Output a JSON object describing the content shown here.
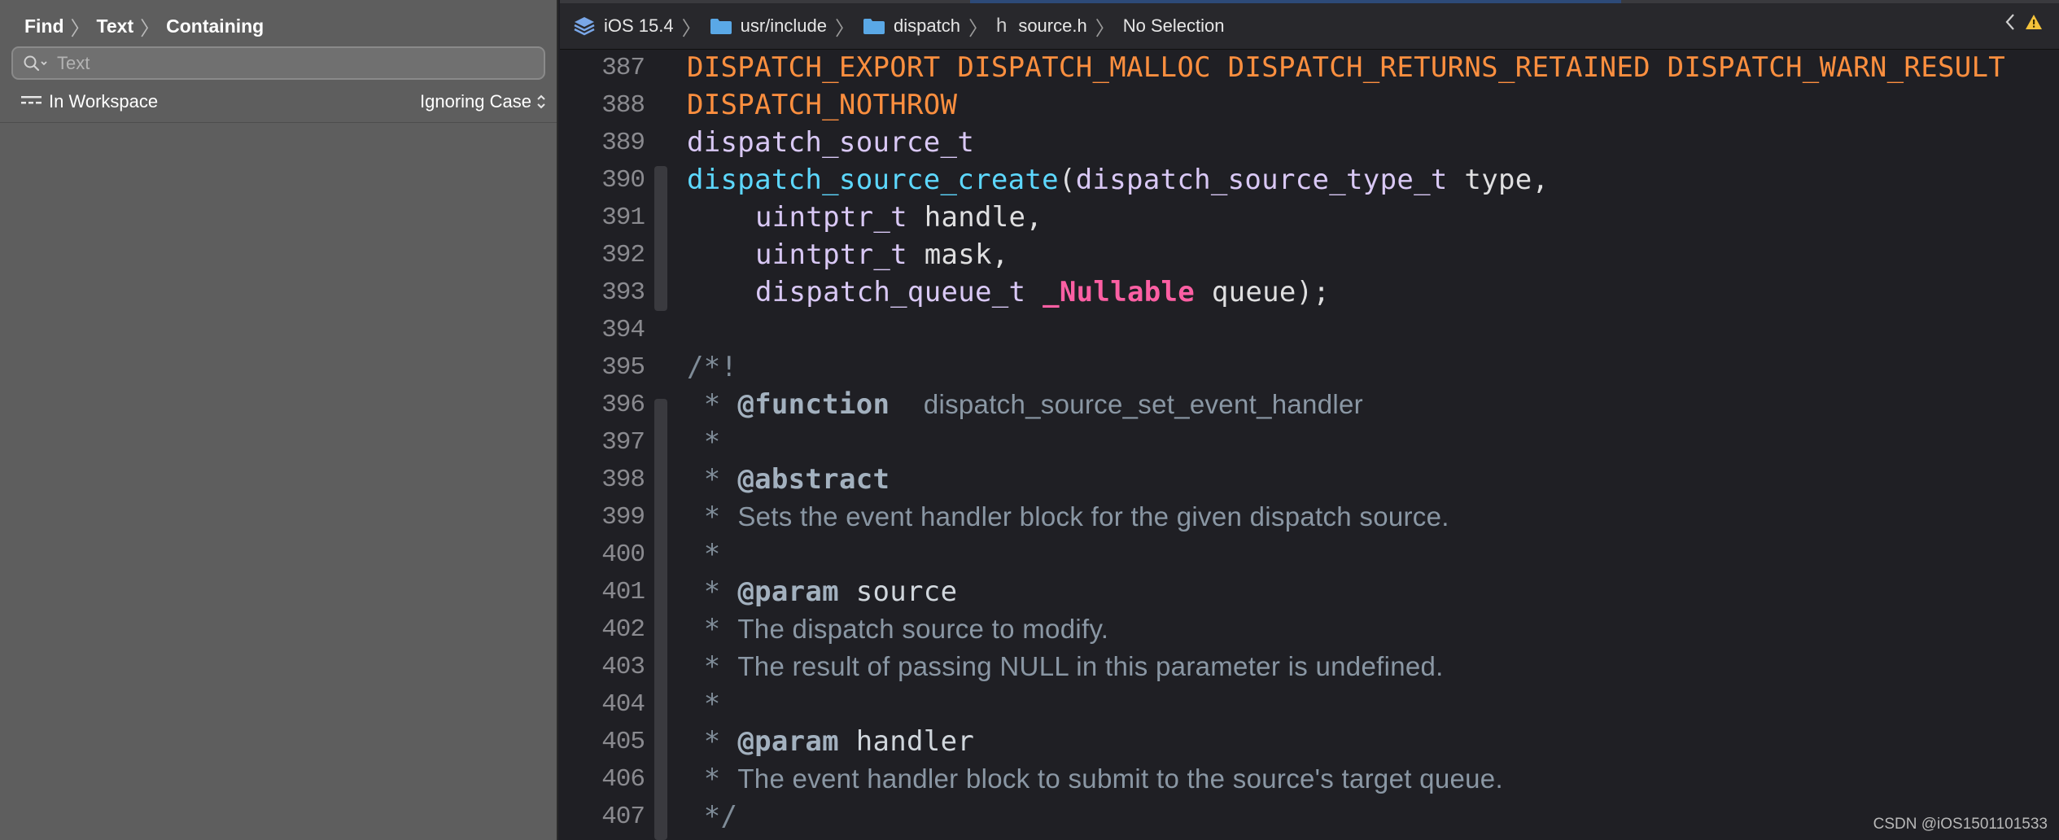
{
  "navigator": {
    "find_mode": "Find",
    "find_type": "Text",
    "find_match": "Containing",
    "search_placeholder": "Text",
    "search_value": "",
    "scope": "In Workspace",
    "case_option": "Ignoring Case"
  },
  "jumpbar": {
    "sdk": "iOS 15.4",
    "folder1": "usr/include",
    "folder2": "dispatch",
    "file_prefix": "h",
    "file": "source.h",
    "selection": "No Selection"
  },
  "colors": {
    "macro": "#fd8f3f",
    "type": "#d9c8f5",
    "function": "#5dd8ff",
    "keyword": "#fc5fa3",
    "comment": "#7f8c98",
    "warning": "#f5c33b"
  },
  "code": {
    "lines": [
      {
        "n": "387"
      },
      {
        "n": "388"
      },
      {
        "n": "389"
      },
      {
        "n": "390"
      },
      {
        "n": "391"
      },
      {
        "n": "392"
      },
      {
        "n": "393"
      },
      {
        "n": "394"
      },
      {
        "n": "395"
      },
      {
        "n": "396"
      },
      {
        "n": "397"
      },
      {
        "n": "398"
      },
      {
        "n": "399"
      },
      {
        "n": "400"
      },
      {
        "n": "401"
      },
      {
        "n": "402"
      },
      {
        "n": "403"
      },
      {
        "n": "404"
      },
      {
        "n": "405"
      },
      {
        "n": "406"
      },
      {
        "n": "407"
      }
    ],
    "l387": "DISPATCH_EXPORT DISPATCH_MALLOC DISPATCH_RETURNS_RETAINED DISPATCH_WARN_RESULT",
    "l388": "DISPATCH_NOTHROW",
    "l389": "dispatch_source_t",
    "l390_func": "dispatch_source_create",
    "l390_open": "(",
    "l390_type": "dispatch_source_type_t",
    "l390_rest": " type,",
    "l391_type": "uintptr_t",
    "l391_rest": " handle,",
    "l392_type": "uintptr_t",
    "l392_rest": " mask,",
    "l393_type": "dispatch_queue_t",
    "l393_kw": "_Nullable",
    "l393_rest": " queue);",
    "l395": "/*!",
    "star": " *",
    "end_comment": " */",
    "l396_tag": "@function",
    "l396_text": "dispatch_source_set_event_handler",
    "l398_tag": "@abstract",
    "l399_text": "Sets the event handler block for the given dispatch source.",
    "l401_tag": "@param",
    "l401_arg": " source",
    "l402_text": "The dispatch source to modify.",
    "l403_text": "The result of passing NULL in this parameter is undefined.",
    "l405_tag": "@param",
    "l405_arg": " handler",
    "l406_text": "The event handler block to submit to the source's target queue."
  },
  "watermark": "CSDN @iOS1501101533"
}
